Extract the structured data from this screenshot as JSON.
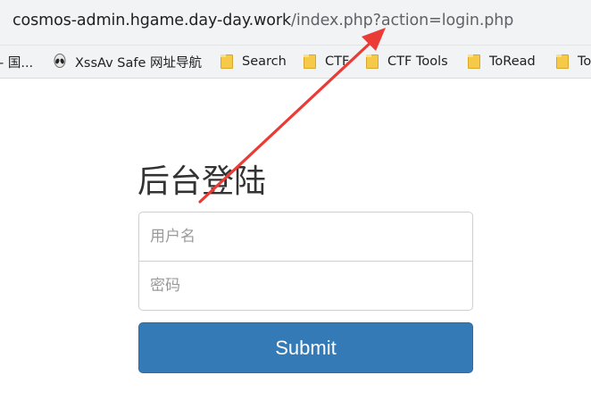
{
  "browser": {
    "url_host": "cosmos-admin.hgame.day-day.work",
    "url_path": "/index.php?action=login.php"
  },
  "bookmarks": [
    {
      "label": "- 国...",
      "icon": "none"
    },
    {
      "label": "XssAv Safe 网址导航",
      "icon": "alien-icon"
    },
    {
      "label": "Search",
      "icon": "folder-icon"
    },
    {
      "label": "CTF",
      "icon": "folder-icon"
    },
    {
      "label": "CTF Tools",
      "icon": "folder-icon"
    },
    {
      "label": "ToRead",
      "icon": "folder-icon"
    },
    {
      "label": "To",
      "icon": "folder-icon"
    }
  ],
  "login": {
    "title": "后台登陆",
    "username_placeholder": "用户名",
    "password_placeholder": "密码",
    "submit_label": "Submit"
  },
  "colors": {
    "accent": "#337ab7",
    "annotation_arrow": "#ea3b36",
    "folder": "#f7c948"
  }
}
